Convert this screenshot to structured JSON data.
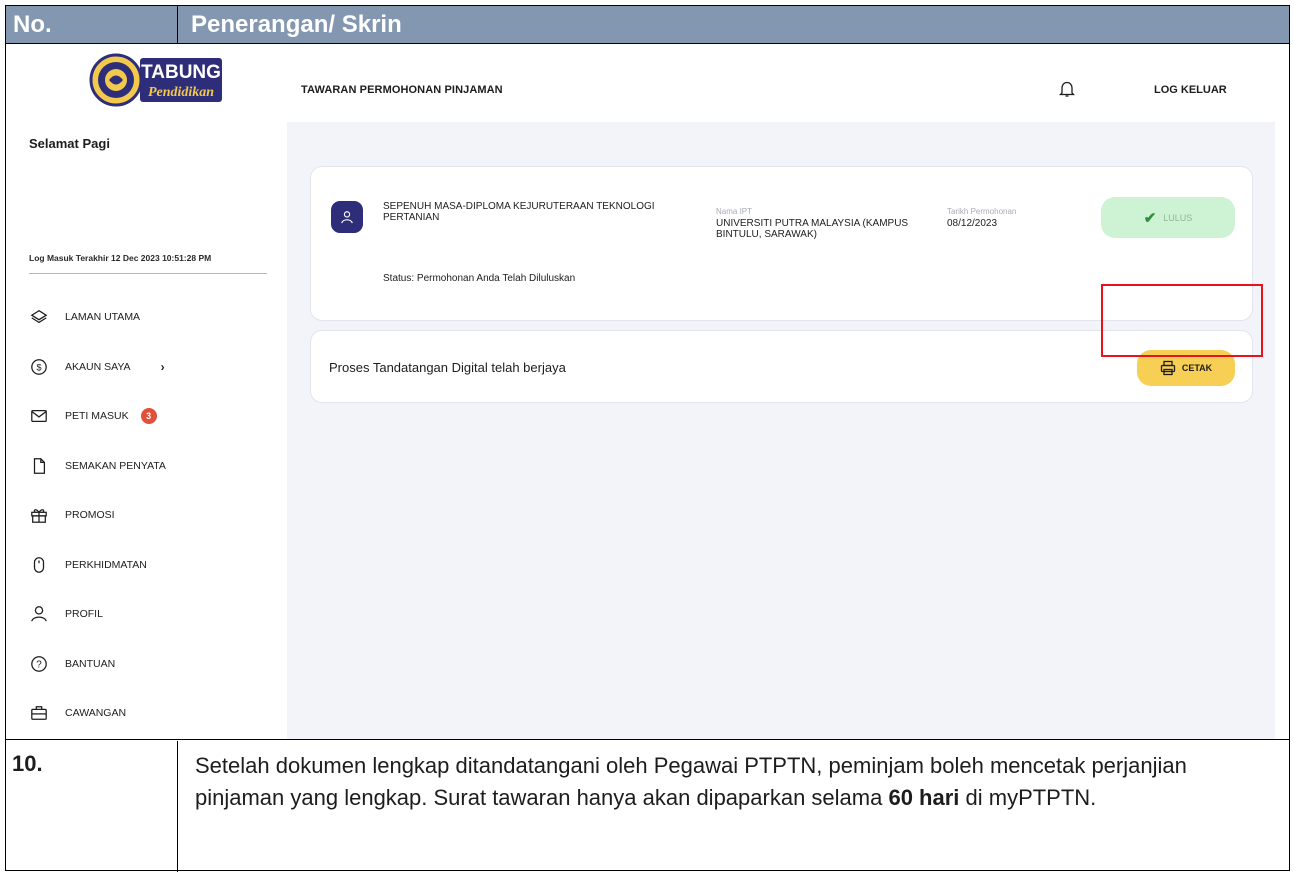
{
  "document": {
    "header_no": "No.",
    "header_desc": "Penerangan/ Skrin",
    "step_number": "10.",
    "step_text_part1": "Setelah dokumen lengkap ditandatangani oleh Pegawai PTPTN, peminjam boleh mencetak perjanjian pinjaman yang lengkap. Surat tawaran hanya akan dipaparkan selama ",
    "step_text_bold": "60 hari",
    "step_text_part2": " di myPTPTN."
  },
  "app": {
    "logo_text": "TABUNG",
    "logo_subtext": "Pendidikan",
    "page_title": "TAWARAN PERMOHONAN PINJAMAN",
    "logout_label": "LOG KELUAR",
    "greeting": "Selamat Pagi",
    "last_login": "Log Masuk Terakhir 12 Dec 2023 10:51:28 PM",
    "nav": [
      {
        "label": "LAMAN UTAMA",
        "icon": "layers-icon"
      },
      {
        "label": "AKAUN SAYA",
        "icon": "dollar-circle-icon",
        "chevron": "›"
      },
      {
        "label": "PETI MASUK",
        "icon": "mail-icon",
        "badge": "3"
      },
      {
        "label": "SEMAKAN PENYATA",
        "icon": "document-icon"
      },
      {
        "label": "PROMOSI",
        "icon": "gift-icon"
      },
      {
        "label": "PERKHIDMATAN",
        "icon": "mouse-icon"
      },
      {
        "label": "PROFIL",
        "icon": "user-icon"
      },
      {
        "label": "BANTUAN",
        "icon": "help-circle-icon"
      },
      {
        "label": "CAWANGAN",
        "icon": "briefcase-icon"
      }
    ]
  },
  "application": {
    "program": "SEPENUH MASA-DIPLOMA KEJURUTERAAN TEKNOLOGI PERTANIAN",
    "ipt_label": "Nama IPT",
    "ipt_value": "UNIVERSITI PUTRA MALAYSIA (KAMPUS BINTULU, SARAWAK)",
    "date_label": "Tarikh Permohonan",
    "date_value": "08/12/2023",
    "status_button": "LULUS",
    "status_text": "Status: Permohonan Anda Telah Diluluskan"
  },
  "signature": {
    "message": "Proses Tandatangan Digital telah berjaya",
    "print_button": "CETAK"
  },
  "colors": {
    "header_bg": "#8497b0",
    "avatar_bg": "#2d2d7a",
    "lulus_bg": "#cdf2d4",
    "cetak_bg": "#f8cf55",
    "highlight": "#e8131d",
    "badge": "#e0503a"
  }
}
